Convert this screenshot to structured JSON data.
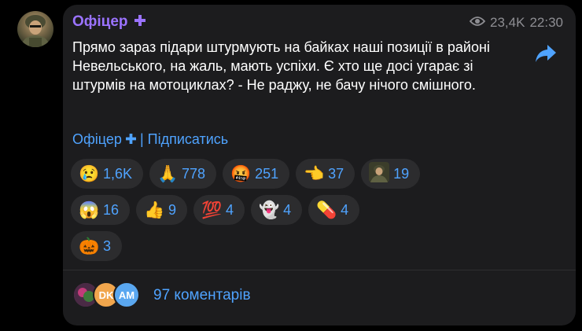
{
  "post": {
    "author": "Офіцер",
    "views": "23,4K",
    "time": "22:30",
    "text": "Прямо зараз підари штурмують на байках наші позиції в районі Невельського, на жаль, мають успіхи. Є хто ще досі угарає зі штурмів на мотоциклах? - Не раджу, не бачу нічого смішного.",
    "channel_link": "Офіцер",
    "subscribe_label": "| Підписатись"
  },
  "reactions": [
    {
      "icon": "crying-face-icon",
      "glyph": "😢",
      "count": "1,6K"
    },
    {
      "icon": "folded-hands-icon",
      "glyph": "🙏",
      "count": "778"
    },
    {
      "icon": "cursing-face-icon",
      "glyph": "🤬",
      "count": "251"
    },
    {
      "icon": "pointing-hand-icon",
      "glyph": "👈",
      "count": "37"
    },
    {
      "icon": "channel-avatar-icon",
      "glyph": "",
      "count": "19"
    },
    {
      "icon": "screaming-face-icon",
      "glyph": "😱",
      "count": "16"
    },
    {
      "icon": "thumbs-up-icon",
      "glyph": "👍",
      "count": "9"
    },
    {
      "icon": "hundred-points-icon",
      "glyph": "💯",
      "count": "4"
    },
    {
      "icon": "ghost-icon",
      "glyph": "👻",
      "count": "4"
    },
    {
      "icon": "pill-icon",
      "glyph": "💊",
      "count": "4"
    },
    {
      "icon": "jack-o-lantern-icon",
      "glyph": "🎃",
      "count": "3"
    }
  ],
  "comments": {
    "label": "97 коментарів",
    "avatars": [
      {
        "initials": "",
        "color": "#6b3b5e"
      },
      {
        "initials": "DK",
        "color": "#f1a64d"
      },
      {
        "initials": "AM",
        "color": "#5aa7f0"
      }
    ]
  },
  "colors": {
    "accent": "#4fa3ff",
    "author": "#9b73ff",
    "bubble": "#1c1c1e",
    "pill": "#2c2c2e",
    "meta": "#8e8e93"
  }
}
